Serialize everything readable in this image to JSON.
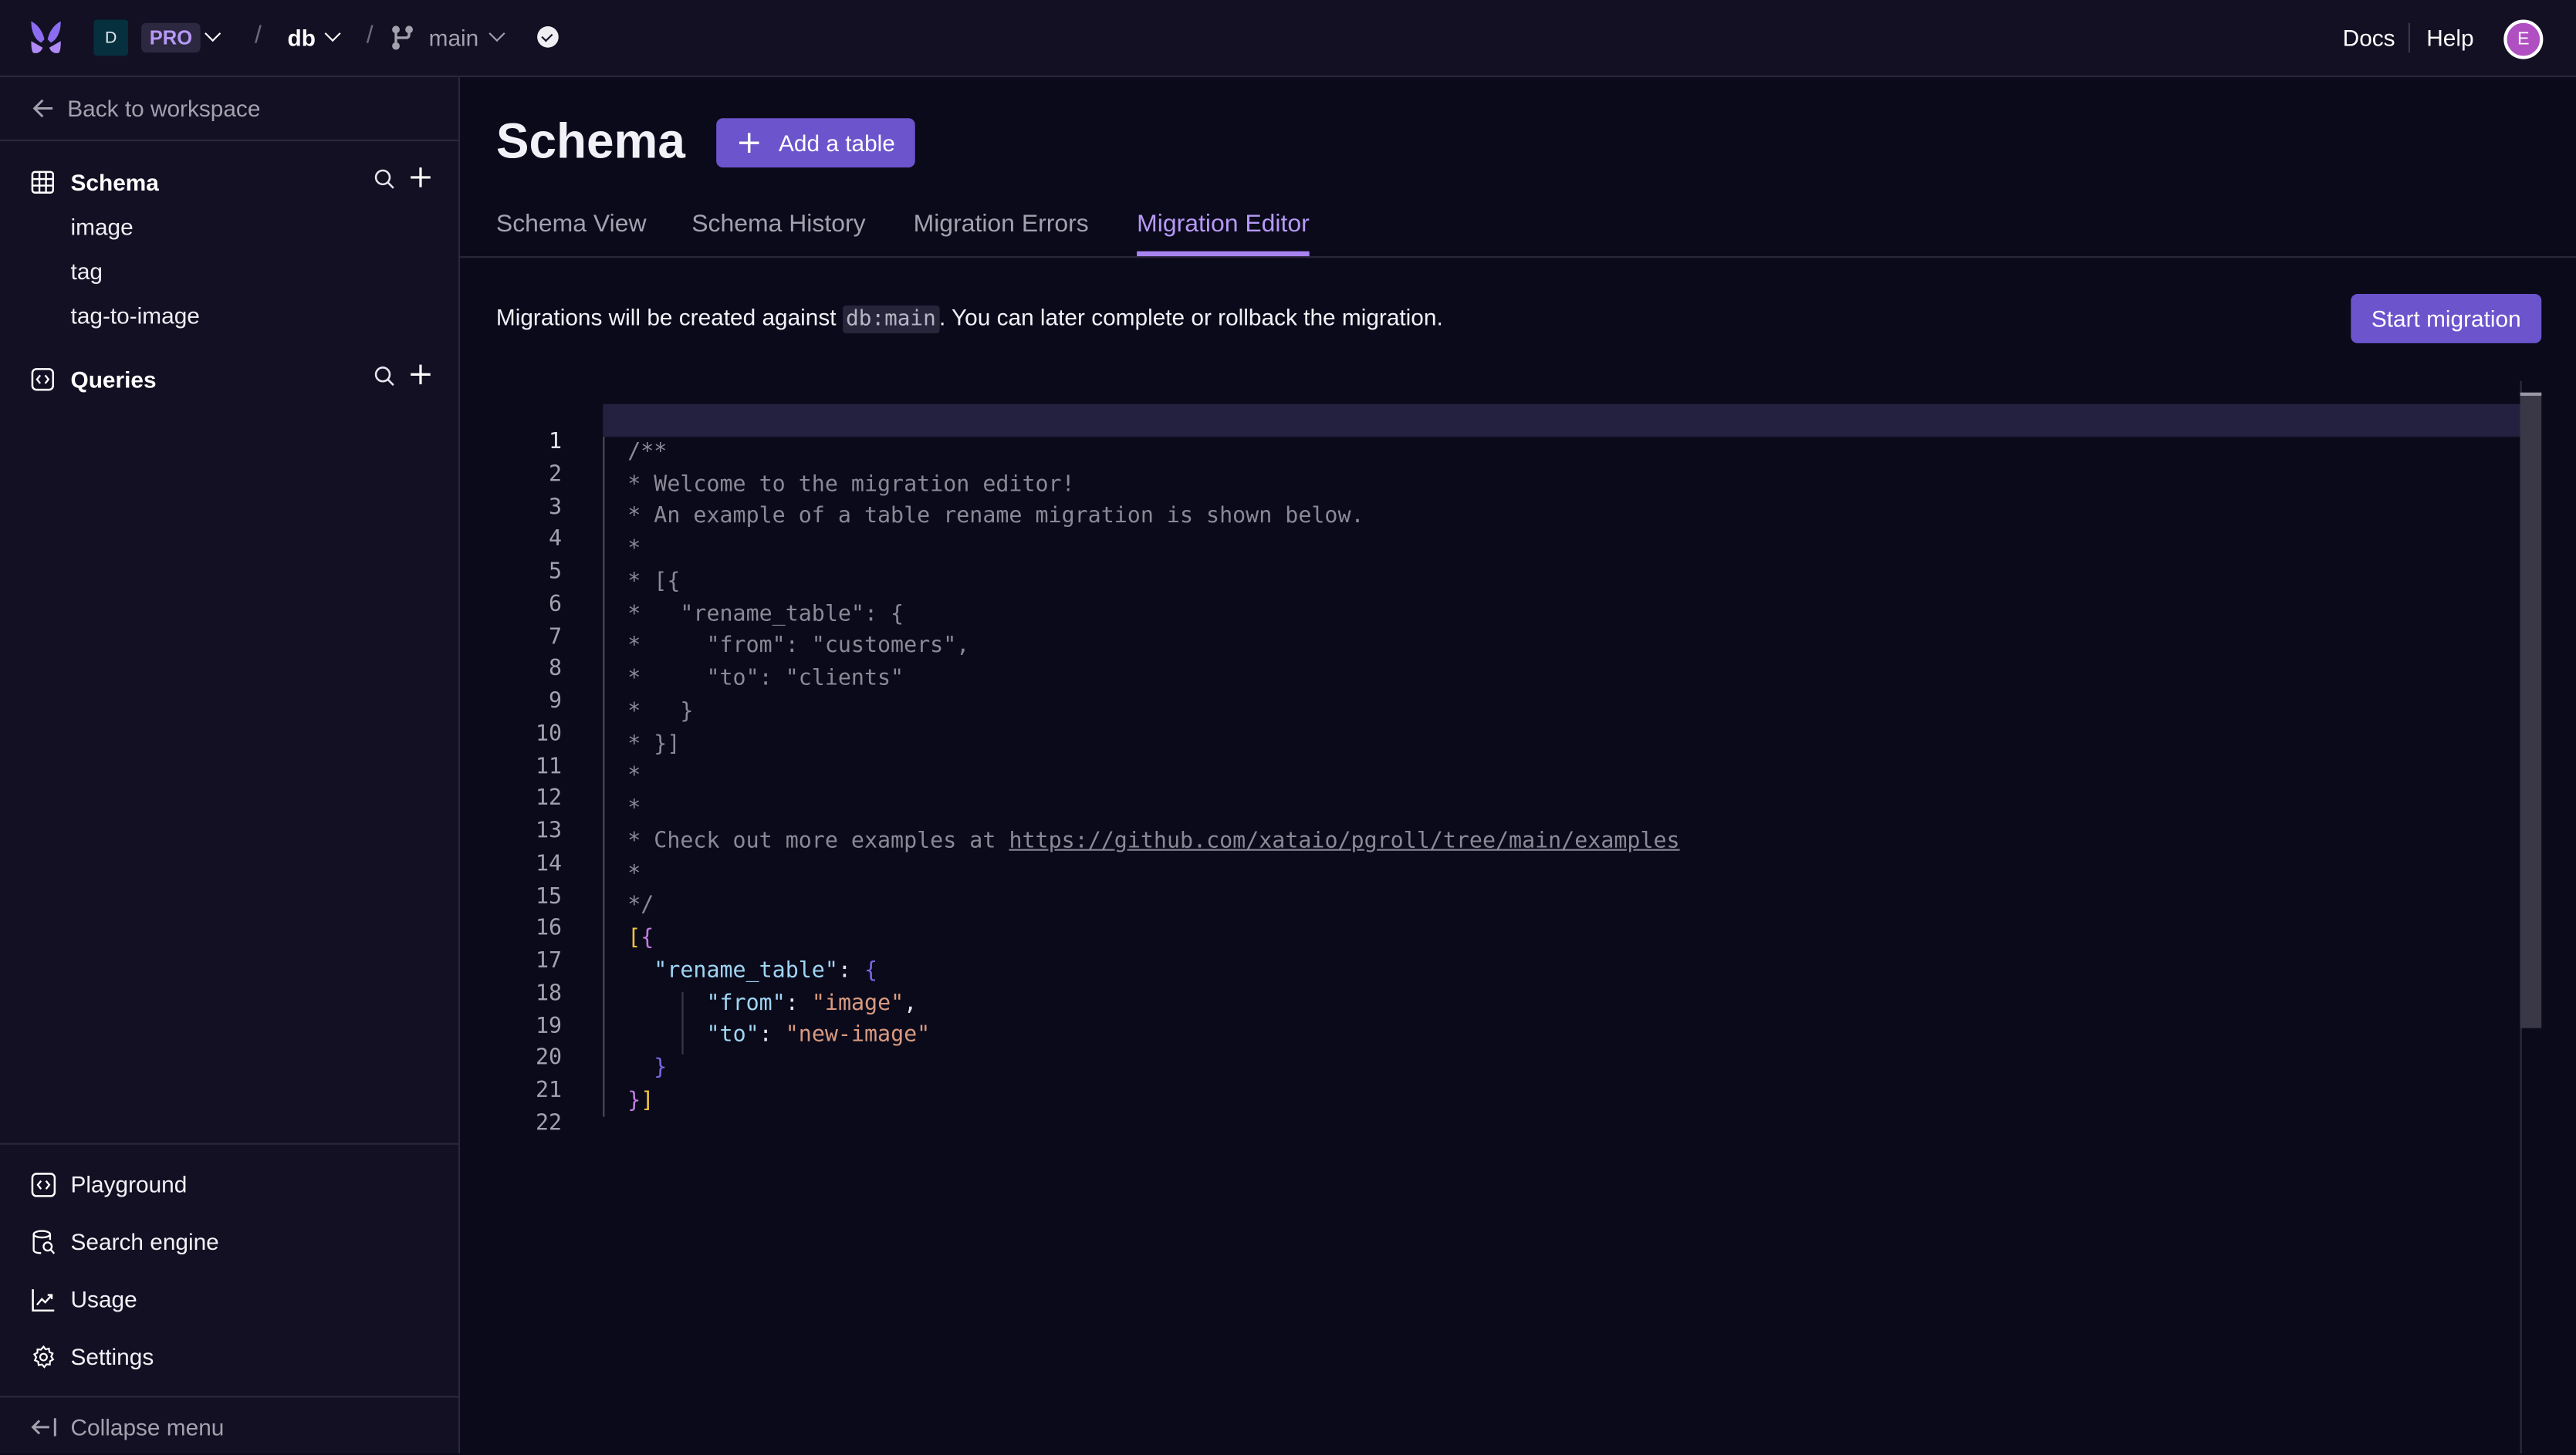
{
  "header": {
    "workspace_initial": "D",
    "plan_badge": "PRO",
    "separator": "/",
    "database": "db",
    "branch": "main",
    "branch_status": "ok",
    "links": {
      "docs": "Docs",
      "help": "Help"
    },
    "user_initial": "E"
  },
  "sidebar": {
    "back_label": "Back to workspace",
    "schema": {
      "label": "Schema",
      "tables": [
        "image",
        "tag",
        "tag-to-image"
      ]
    },
    "queries": {
      "label": "Queries"
    },
    "nav": [
      {
        "label": "Playground",
        "icon": "code-icon"
      },
      {
        "label": "Search engine",
        "icon": "database-search-icon"
      },
      {
        "label": "Usage",
        "icon": "chart-line-icon"
      },
      {
        "label": "Settings",
        "icon": "gear-icon"
      }
    ],
    "collapse_label": "Collapse menu"
  },
  "main": {
    "title": "Schema",
    "add_table_label": "Add a table",
    "tabs": [
      {
        "label": "Schema View",
        "active": false
      },
      {
        "label": "Schema History",
        "active": false
      },
      {
        "label": "Migration Errors",
        "active": false
      },
      {
        "label": "Migration Editor",
        "active": true
      }
    ],
    "info_prefix": "Migrations will be created against ",
    "info_code": "db:main",
    "info_suffix": ". You can later complete or rollback the migration.",
    "start_migration_label": "Start migration"
  },
  "editor": {
    "active_line": 1,
    "lines": [
      "",
      "/**",
      "* Welcome to the migration editor!",
      "* An example of a table rename migration is shown below.",
      "*",
      "* [{",
      "*   \"rename_table\": {",
      "*     \"from\": \"customers\",",
      "*     \"to\": \"clients\"",
      "*   }",
      "* }]",
      "*",
      "*",
      "* Check out more examples at https://github.com/xataio/pgroll/tree/main/examples",
      "*",
      "*/",
      "[{",
      "  \"rename_table\": {",
      "      \"from\": \"image\",",
      "      \"to\": \"new-image\"",
      "  }",
      "}]"
    ],
    "comment_link": "https://github.com/xataio/pgroll/tree/main/examples",
    "comment_link_prefix": "* Check out more examples at ",
    "json": {
      "key_rename": "\"rename_table\"",
      "key_from": "\"from\"",
      "val_from": "\"image\"",
      "key_to": "\"to\"",
      "val_to": "\"new-image\""
    }
  },
  "colors": {
    "accent": "#6b54cc",
    "accent_text": "#b699f5",
    "background": "#0b0a1b",
    "sidebar_bg": "#121022",
    "active_line": "#24203f"
  }
}
